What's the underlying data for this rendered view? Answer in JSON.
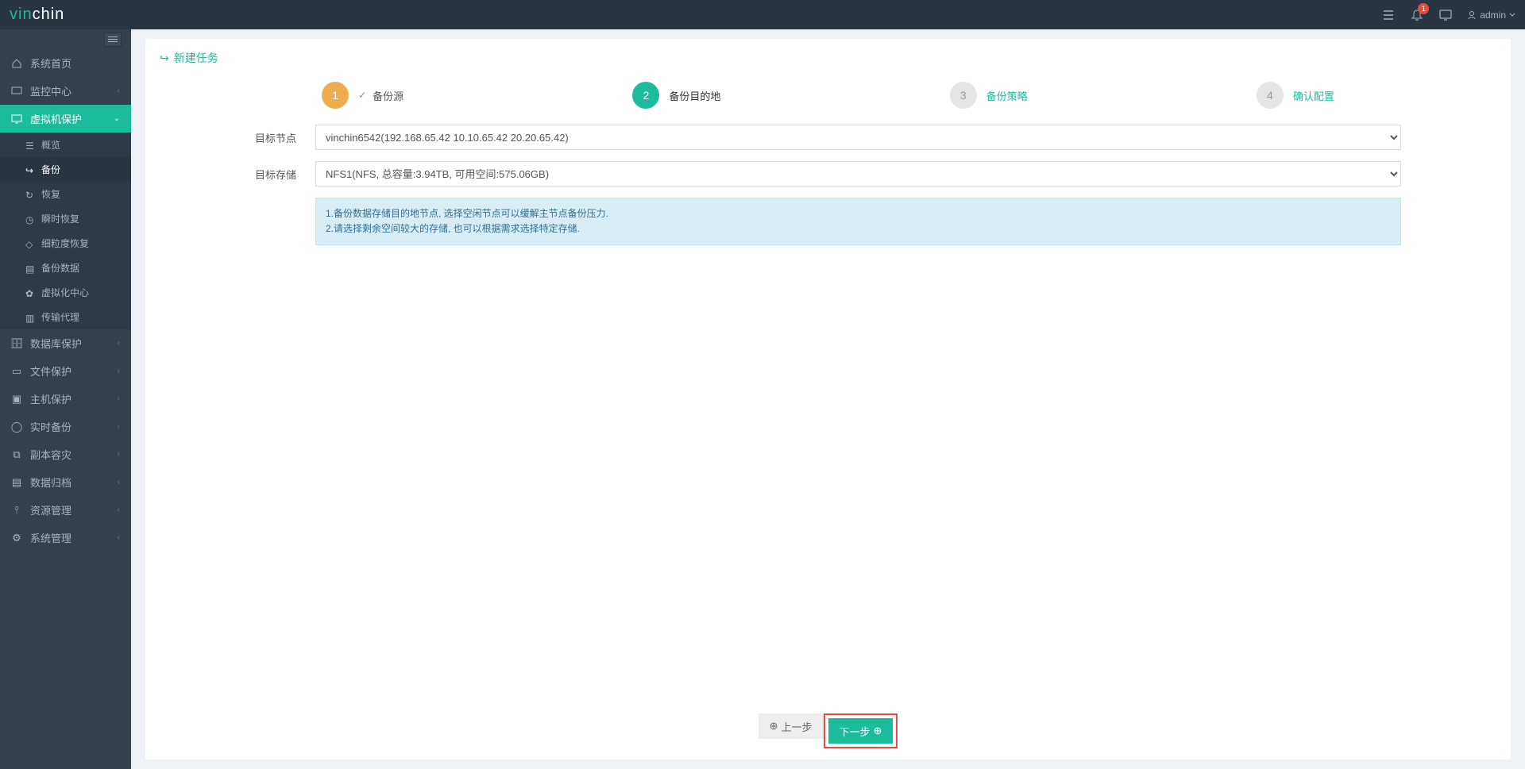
{
  "topbar": {
    "logo_prefix": "vin",
    "logo_suffix": "chin",
    "notif_count": "1",
    "username": "admin"
  },
  "sidebar": {
    "home": "系统首页",
    "monitor": "监控中心",
    "vm_protect": "虚拟机保护",
    "vm_sub": {
      "overview": "概览",
      "backup": "备份",
      "restore": "恢复",
      "instant": "瞬时恢复",
      "granular": "细粒度恢复",
      "data": "备份数据",
      "virt_center": "虚拟化中心",
      "proxy": "传输代理"
    },
    "db_protect": "数据库保护",
    "file_protect": "文件保护",
    "host_protect": "主机保护",
    "realtime": "实时备份",
    "replica": "副本容灾",
    "archive": "数据归档",
    "resource": "资源管理",
    "system": "系统管理"
  },
  "panel": {
    "title": "新建任务"
  },
  "wizard": {
    "step1": {
      "num": "1",
      "label": "备份源"
    },
    "step2": {
      "num": "2",
      "label": "备份目的地"
    },
    "step3": {
      "num": "3",
      "label": "备份策略"
    },
    "step4": {
      "num": "4",
      "label": "确认配置"
    }
  },
  "form": {
    "target_node_label": "目标节点",
    "target_node_value": "vinchin6542(192.168.65.42 10.10.65.42 20.20.65.42)",
    "target_storage_label": "目标存储",
    "target_storage_value": "NFS1(NFS, 总容量:3.94TB, 可用空间:575.06GB)",
    "info_line1": "1.备份数据存储目的地节点, 选择空闲节点可以缓解主节点备份压力.",
    "info_line2": "2.请选择剩余空间较大的存储, 也可以根据需求选择特定存储."
  },
  "buttons": {
    "prev": "上一步",
    "next": "下一步"
  }
}
